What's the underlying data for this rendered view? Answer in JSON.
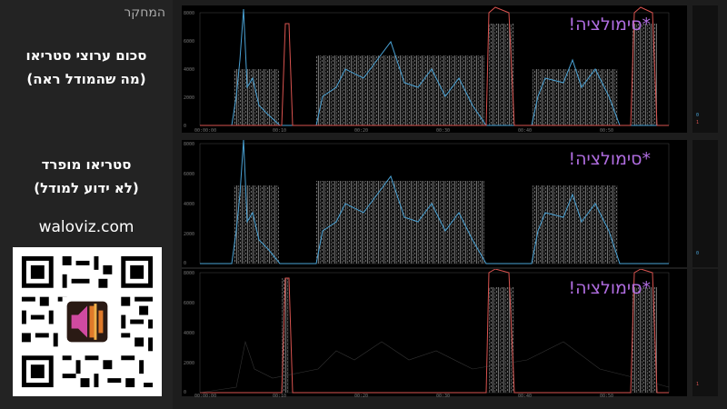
{
  "sidebar": {
    "corner_label": "המחקר",
    "mix_title_line1": "סכום ערוצי סטריאו",
    "mix_title_line2": "(מה שהמודל ראה)",
    "sep_title_line1": "סטריאו מופרד",
    "sep_title_line2": "(לא ידוע למודל)",
    "url": "waloviz.com"
  },
  "panels": [
    {
      "sim_label": "*סימולציה!",
      "y_ticks": [
        "8000",
        "6000",
        "4000",
        "2000",
        "0"
      ],
      "x_ticks": [
        "00:00:00",
        "00:10",
        "00:20",
        "00:30",
        "00:40",
        "00:50"
      ],
      "legend": [
        "0",
        "1"
      ]
    },
    {
      "sim_label": "*סימולציה!",
      "y_ticks": [
        "8000",
        "6000",
        "4000",
        "2000",
        "0"
      ],
      "x_ticks": [
        "00:00:00",
        "00:10",
        "00:20",
        "00:30",
        "00:40",
        "00:50"
      ],
      "legend": [
        "0"
      ]
    },
    {
      "sim_label": "*סימולציה!",
      "y_ticks": [
        "8000",
        "6000",
        "4000",
        "2000",
        "0"
      ],
      "x_ticks": [
        "00:00:00",
        "00:10",
        "00:20",
        "00:30",
        "00:40",
        "00:50"
      ],
      "legend": [
        "1"
      ]
    }
  ],
  "colors": {
    "blue_channel": "#4aa3d6",
    "red_channel": "#d9534f",
    "sim_text": "#b06de0"
  }
}
